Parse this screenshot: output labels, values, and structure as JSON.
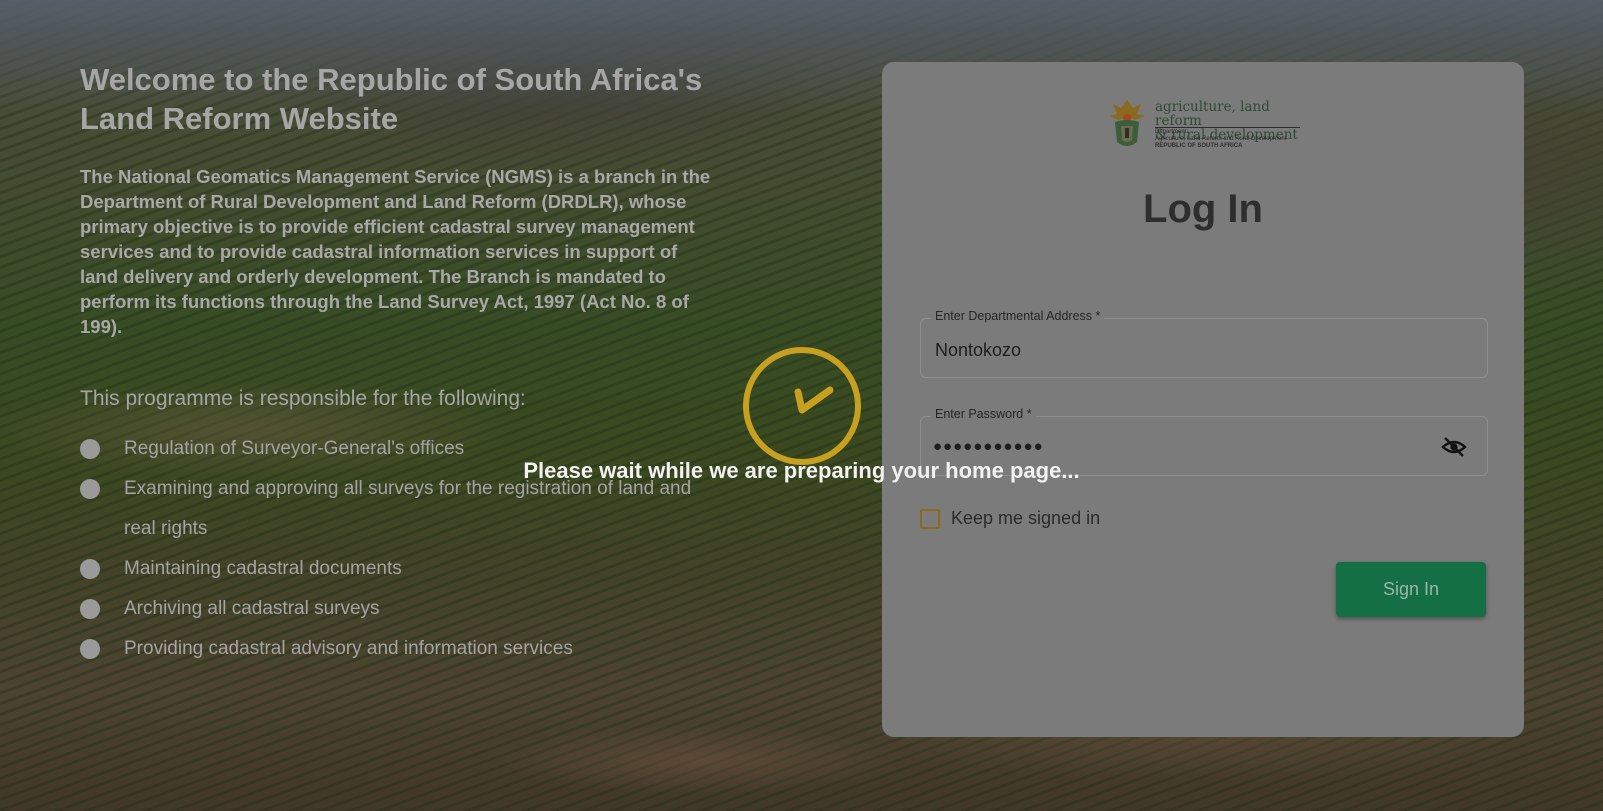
{
  "left": {
    "title_line1": "Welcome to the Republic of South Africa's",
    "title_line2": "Land Reform Website",
    "intro": "The National Geomatics Management Service (NGMS) is a branch in the Department of Rural Development and Land Reform (DRDLR), whose primary objective is to provide efficient cadastral survey management services and to provide cadastral information services in support of land delivery and orderly development. The Branch is mandated to perform its functions through the Land Survey Act, 1997 (Act No. 8 of 199).",
    "programme_heading": "This programme is responsible for the following:",
    "items": [
      "Regulation of Surveyor-General's offices",
      "Examining and approving all surveys for the registration of land and real rights",
      "Maintaining cadastral documents",
      "Archiving all cadastral surveys",
      "Providing cadastral advisory and information services"
    ]
  },
  "logo": {
    "line1": "agriculture, land reform",
    "line2": "& rural development",
    "dept": "Department:",
    "dept_name": "Agriculture, Land Reform and Rural Development",
    "country": "REPUBLIC OF SOUTH AFRICA"
  },
  "login": {
    "title": "Log In",
    "address_label": "Enter Departmental Address *",
    "address_value": "Nontokozo",
    "password_label": "Enter Password *",
    "password_value": "●●●●●●●●●●●",
    "keep_signed_in": "Keep me signed in",
    "sign_in": "Sign In"
  },
  "overlay": {
    "message": "Please wait while we are preparing your home page..."
  },
  "colors": {
    "accent_gold": "#c8a020",
    "signin_green": "#156f45"
  }
}
